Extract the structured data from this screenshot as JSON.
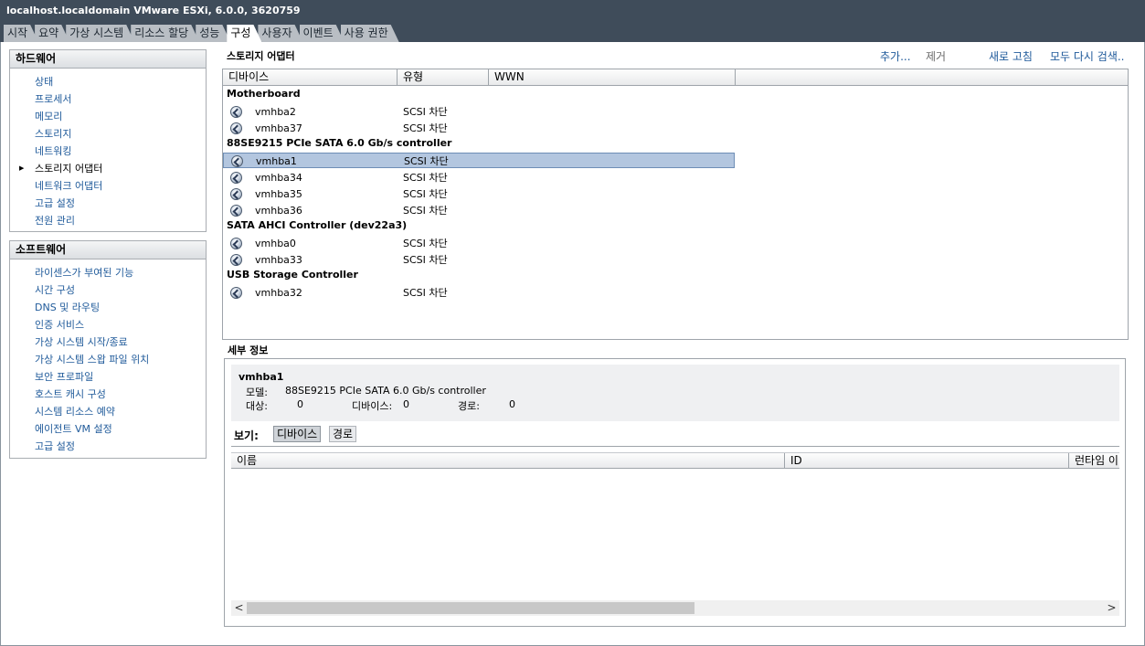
{
  "window": {
    "title": "localhost.localdomain VMware ESXi, 6.0.0, 3620759"
  },
  "tabs": [
    {
      "label": "시작"
    },
    {
      "label": "요약"
    },
    {
      "label": "가상 시스템"
    },
    {
      "label": "리소스 할당"
    },
    {
      "label": "성능"
    },
    {
      "label": "구성"
    },
    {
      "label": "사용자"
    },
    {
      "label": "이벤트"
    },
    {
      "label": "사용 권한"
    }
  ],
  "active_tab": "구성",
  "hardware": {
    "title": "하드웨어",
    "items": [
      {
        "label": "상태"
      },
      {
        "label": "프로세서"
      },
      {
        "label": "메모리"
      },
      {
        "label": "스토리지"
      },
      {
        "label": "네트워킹"
      },
      {
        "label": "스토리지 어댑터"
      },
      {
        "label": "네트워크 어댑터"
      },
      {
        "label": "고급 설정"
      },
      {
        "label": "전원 관리"
      }
    ],
    "selected": "스토리지 어댑터"
  },
  "software": {
    "title": "소프트웨어",
    "items": [
      {
        "label": "라이센스가 부여된 기능"
      },
      {
        "label": "시간 구성"
      },
      {
        "label": "DNS 및 라우팅"
      },
      {
        "label": "인증 서비스"
      },
      {
        "label": "가상 시스템 시작/종료"
      },
      {
        "label": "가상 시스템 스왑 파일 위치"
      },
      {
        "label": "보안 프로파일"
      },
      {
        "label": "호스트 캐시 구성"
      },
      {
        "label": "시스템 리소스 예약"
      },
      {
        "label": "에이전트 VM 설정"
      },
      {
        "label": "고급 설정"
      }
    ]
  },
  "storage_adapters": {
    "title": "스토리지 어댑터",
    "actions": {
      "add": "추가...",
      "remove": "제거",
      "refresh": "새로 고침",
      "rescan": "모두 다시 검색.."
    },
    "columns": [
      "디바이스",
      "유형",
      "WWN"
    ],
    "groups": [
      {
        "name": "Motherboard",
        "adapters": [
          {
            "name": "vmhba2",
            "type": "SCSI 차단"
          },
          {
            "name": "vmhba37",
            "type": "SCSI 차단"
          }
        ]
      },
      {
        "name": "88SE9215 PCIe SATA 6.0 Gb/s controller",
        "adapters": [
          {
            "name": "vmhba1",
            "type": "SCSI 차단"
          },
          {
            "name": "vmhba34",
            "type": "SCSI 차단"
          },
          {
            "name": "vmhba35",
            "type": "SCSI 차단"
          },
          {
            "name": "vmhba36",
            "type": "SCSI 차단"
          }
        ]
      },
      {
        "name": "SATA AHCI Controller (dev22a3)",
        "adapters": [
          {
            "name": "vmhba0",
            "type": "SCSI 차단"
          },
          {
            "name": "vmhba33",
            "type": "SCSI 차단"
          }
        ]
      },
      {
        "name": "USB Storage Controller",
        "adapters": [
          {
            "name": "vmhba32",
            "type": "SCSI 차단"
          }
        ]
      }
    ],
    "selected": "vmhba1"
  },
  "details": {
    "title": "세부 정보",
    "adapter_name": "vmhba1",
    "model_label": "모델:",
    "model_value": "88SE9215 PCIe SATA 6.0 Gb/s controller",
    "target_label": "대상:",
    "target_value": "0",
    "devices_label": "디바이스:",
    "devices_value": "0",
    "paths_label": "경로:",
    "paths_value": "0",
    "view_label": "보기:",
    "view_buttons": [
      "디바이스",
      "경로"
    ],
    "active_view": "디바이스",
    "columns": [
      "이름",
      "ID",
      "런타임 이"
    ]
  }
}
